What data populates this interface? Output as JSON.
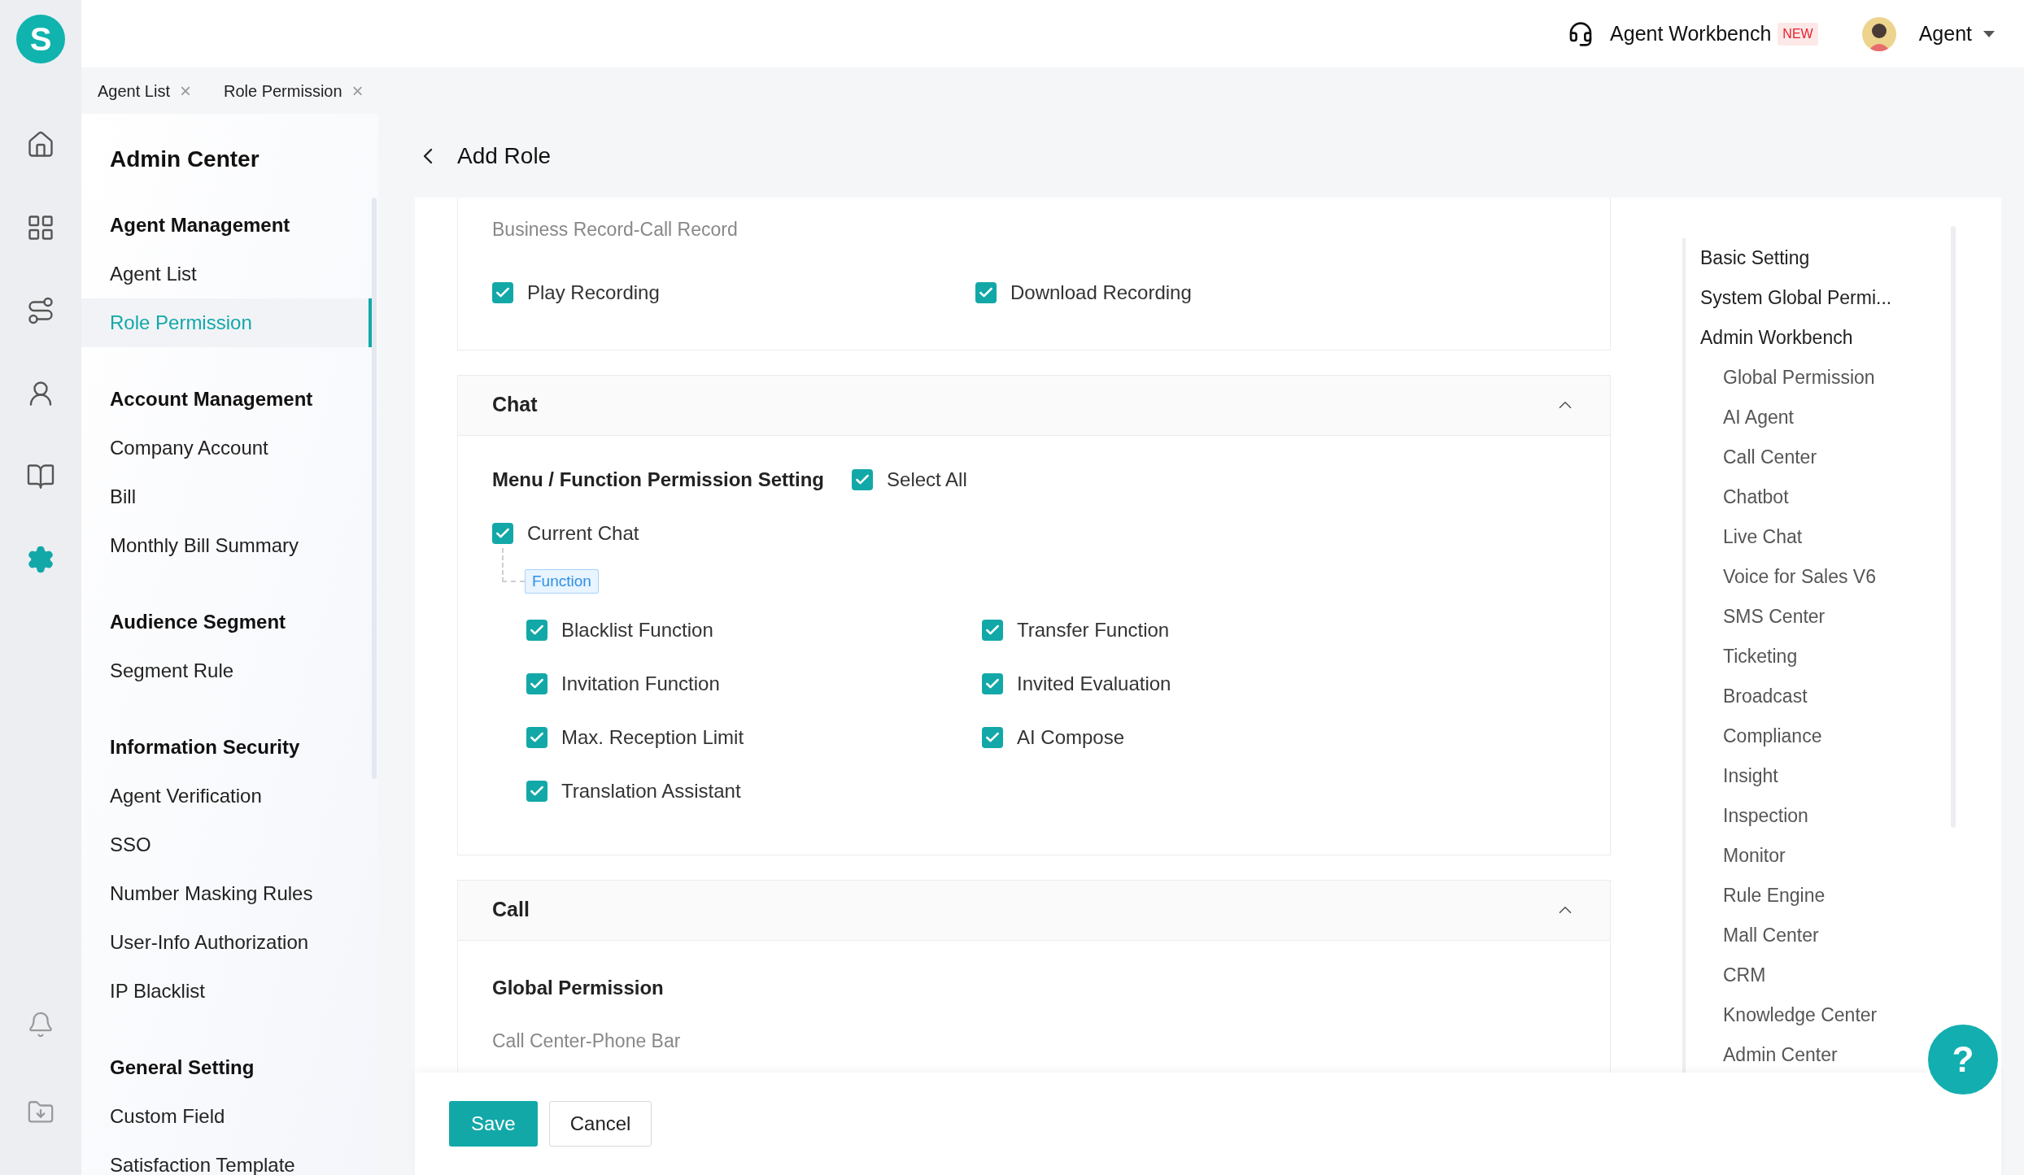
{
  "logo": {
    "letter": "S"
  },
  "rail": [
    {
      "selected": false
    },
    {
      "selected": false
    },
    {
      "selected": false
    },
    {
      "selected": false
    },
    {
      "selected": false
    },
    {
      "selected": true
    },
    {
      "selected": false
    },
    {
      "selected": false
    }
  ],
  "header": {
    "workbench": "Agent Workbench",
    "badge": "NEW",
    "user": "Agent"
  },
  "tabs": [
    {
      "label": "Agent List",
      "close": "×"
    },
    {
      "label": "Role Permission",
      "close": "×"
    }
  ],
  "sidebar": {
    "title": "Admin Center",
    "groups": [
      {
        "title": "Agent Management",
        "items": [
          {
            "label": "Agent List",
            "selected": false
          },
          {
            "label": "Role Permission",
            "selected": true
          }
        ]
      },
      {
        "title": "Account Management",
        "items": [
          {
            "label": "Company Account",
            "selected": false
          },
          {
            "label": "Bill",
            "selected": false
          },
          {
            "label": "Monthly Bill Summary",
            "selected": false
          }
        ]
      },
      {
        "title": "Audience Segment",
        "items": [
          {
            "label": "Segment Rule",
            "selected": false
          }
        ]
      },
      {
        "title": "Information Security",
        "items": [
          {
            "label": "Agent Verification",
            "selected": false
          },
          {
            "label": "SSO",
            "selected": false
          },
          {
            "label": "Number Masking Rules",
            "selected": false
          },
          {
            "label": "User-Info Authorization",
            "selected": false
          },
          {
            "label": "IP Blacklist",
            "selected": false
          }
        ]
      },
      {
        "title": "General Setting",
        "items": [
          {
            "label": "Custom Field",
            "selected": false
          },
          {
            "label": "Satisfaction Template",
            "selected": false
          }
        ]
      }
    ]
  },
  "page": {
    "title": "Add Role"
  },
  "record_section": {
    "subtitle": "Business Record-Call Record",
    "options": [
      {
        "label": "Play Recording",
        "checked": true
      },
      {
        "label": "Download Recording",
        "checked": true
      }
    ]
  },
  "chat_section": {
    "title": "Chat",
    "expanded": true,
    "setting_label": "Menu / Function Permission Setting",
    "select_all": {
      "label": "Select All",
      "checked": true
    },
    "menu": {
      "label": "Current Chat",
      "checked": true
    },
    "group_tag": "Function",
    "functions": [
      {
        "label": "Blacklist Function",
        "checked": true
      },
      {
        "label": "Transfer Function",
        "checked": true
      },
      {
        "label": "Invitation Function",
        "checked": true
      },
      {
        "label": "Invited Evaluation",
        "checked": true
      },
      {
        "label": "Max. Reception Limit",
        "checked": true
      },
      {
        "label": "AI Compose",
        "checked": true
      },
      {
        "label": "Translation Assistant",
        "checked": true
      }
    ]
  },
  "call_section": {
    "title": "Call",
    "expanded": true,
    "heading": "Global Permission",
    "subtitle": "Call Center-Phone Bar"
  },
  "anchor_nav": [
    {
      "label": "Basic Setting"
    },
    {
      "label": "System Global Permi..."
    },
    {
      "label": "Admin Workbench",
      "children": [
        {
          "label": "Global Permission"
        },
        {
          "label": "AI Agent"
        },
        {
          "label": "Call Center"
        },
        {
          "label": "Chatbot"
        },
        {
          "label": "Live Chat"
        },
        {
          "label": "Voice for Sales V6"
        },
        {
          "label": "SMS Center"
        },
        {
          "label": "Ticketing"
        },
        {
          "label": "Broadcast"
        },
        {
          "label": "Compliance"
        },
        {
          "label": "Insight"
        },
        {
          "label": "Inspection"
        },
        {
          "label": "Monitor"
        },
        {
          "label": "Rule Engine"
        },
        {
          "label": "Mall Center"
        },
        {
          "label": "CRM"
        },
        {
          "label": "Knowledge Center"
        },
        {
          "label": "Admin Center"
        }
      ]
    }
  ],
  "footer": {
    "save": "Save",
    "cancel": "Cancel"
  },
  "help_button": "?"
}
